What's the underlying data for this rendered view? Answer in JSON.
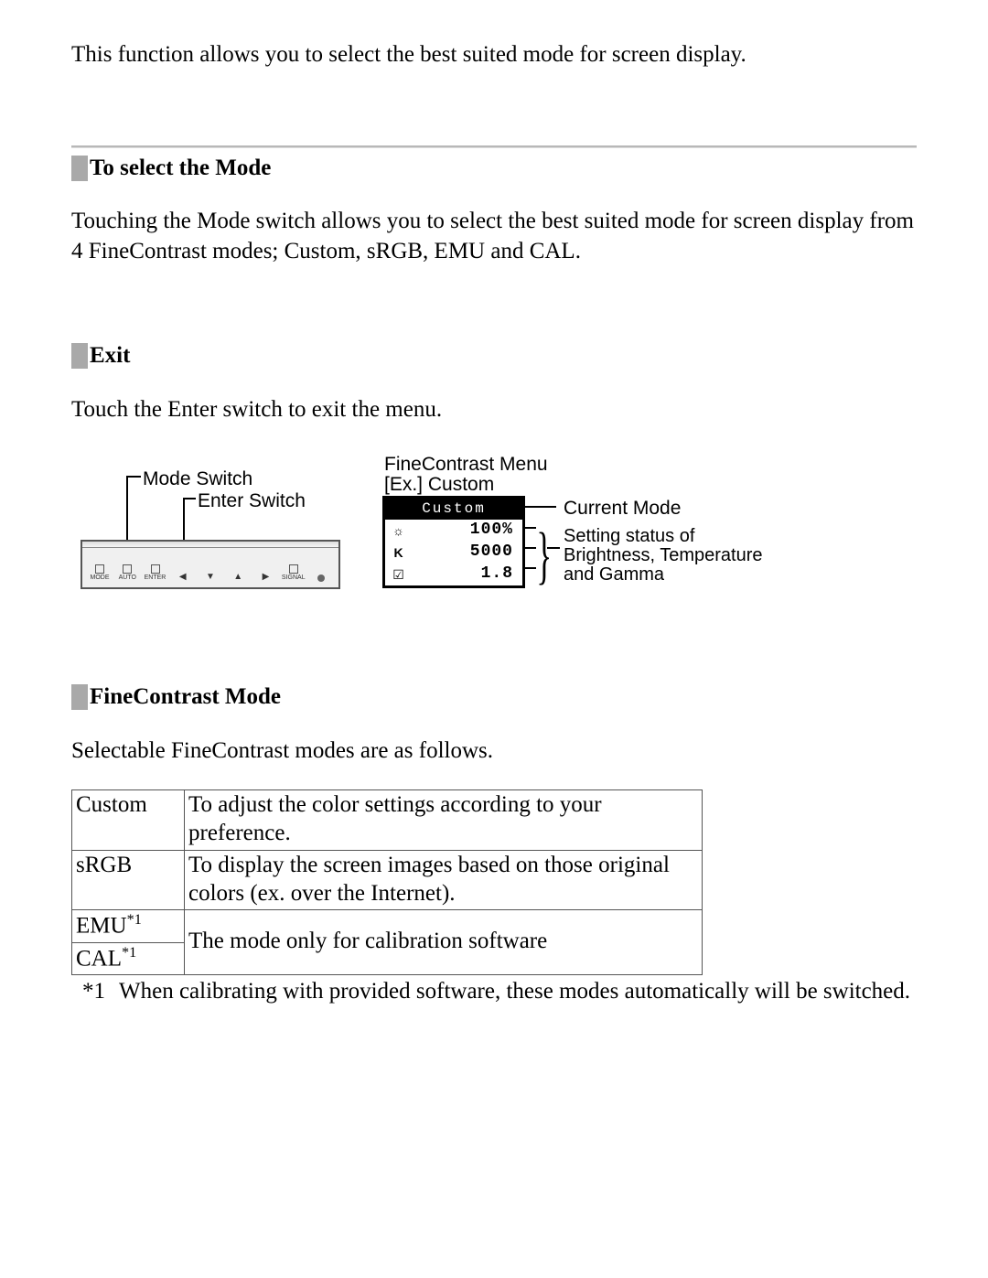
{
  "intro": "This function allows you to select the best suited mode for screen display.",
  "sec_select": {
    "title": "To select the Mode",
    "body": "Touching the Mode switch allows you to select the best suited mode for screen display from 4 FineContrast modes; Custom, sRGB, EMU and CAL."
  },
  "sec_exit": {
    "title": "Exit",
    "body": "Touch the Enter switch to exit the menu."
  },
  "figure": {
    "label_mode_switch": "Mode Switch",
    "label_enter_switch": "Enter Switch",
    "label_menu_line1": "FineContrast Menu",
    "label_menu_line2": "[Ex.] Custom",
    "label_current_mode": "Current Mode",
    "label_settings": "Setting status of Brightness, Temperature and Gamma",
    "osd": {
      "title": "Custom",
      "brightness_icon": "☼",
      "brightness": "100%",
      "temp_icon": "K",
      "temp": "5000",
      "gamma_icon": "☑",
      "gamma": "1.8"
    },
    "bezel_buttons": {
      "mode": "MODE",
      "auto": "AUTO",
      "enter": "ENTER",
      "signal": "SIGNAL",
      "arrows": [
        "◀",
        "▼",
        "▲",
        "▶"
      ]
    }
  },
  "sec_fc": {
    "title": "FineContrast Mode",
    "body": "Selectable FineContrast modes are as follows.",
    "table": {
      "rows": [
        {
          "name": "Custom",
          "desc": "To adjust the color settings according to your preference."
        },
        {
          "name": "sRGB",
          "desc": "To display the screen images based on those original colors (ex. over the Internet)."
        }
      ],
      "merged": {
        "name_emu": "EMU",
        "name_cal": "CAL",
        "sup": "*1",
        "desc": "The mode only for calibration software"
      }
    },
    "footnote": {
      "mark": "*1",
      "text": "When calibrating with provided software, these modes automatically will be switched."
    }
  }
}
